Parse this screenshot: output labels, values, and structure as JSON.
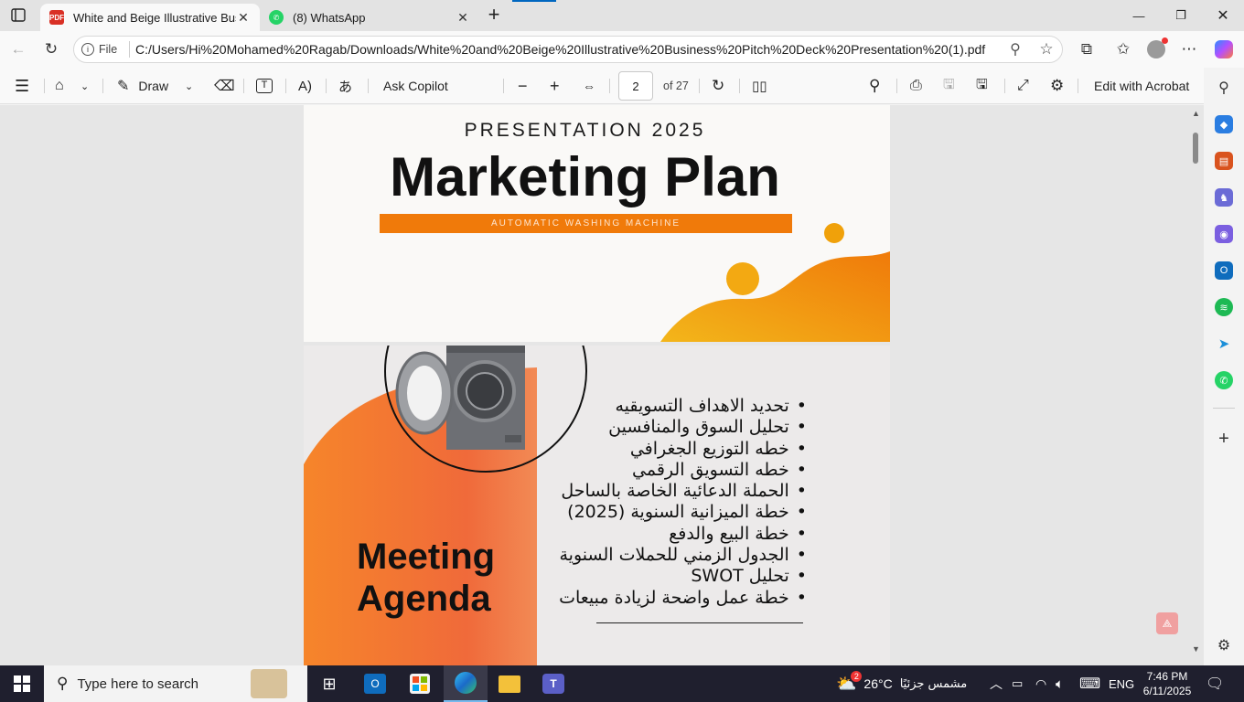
{
  "tabs": [
    {
      "title": "White and Beige Illustrative Busin",
      "icon": "pdf-icon",
      "active": true
    },
    {
      "title": "(8) WhatsApp",
      "icon": "whatsapp-icon",
      "active": false
    }
  ],
  "address": {
    "scheme_label": "File",
    "url": "C:/Users/Hi%20Mohamed%20Ragab/Downloads/White%20and%20Beige%20Illustrative%20Business%20Pitch%20Deck%20Presentation%20(1).pdf"
  },
  "pdf_toolbar": {
    "draw_label": "Draw",
    "copilot_label": "Ask Copilot",
    "page_current": "2",
    "page_total": "of 27",
    "edit_label": "Edit with Acrobat"
  },
  "page1": {
    "subtitle": "PRESENTATION 2025",
    "title": "Marketing Plan",
    "banner": "AUTOMATIC WASHING MACHINE"
  },
  "page2": {
    "heading_line1": "Meeting",
    "heading_line2": "Agenda",
    "agenda_items": [
      "تحديد الاهداف التسويقيه",
      "تحليل السوق والمنافسين",
      "خطه التوزيع الجغرافي",
      "خطه التسويق الرقمي",
      "الحملة الدعائية الخاصة بالساحل",
      "خطة الميزانية السنوية (2025)",
      "خطة البيع والدفع",
      "الجدول الزمني للحملات السنوية",
      "تحليل SWOT",
      "خطة عمل واضحة لزيادة مبيعات"
    ]
  },
  "taskbar": {
    "search_placeholder": "Type here to search",
    "weather_temp": "26°C",
    "weather_desc": "مشمس جزئيًا",
    "weather_badge": "2",
    "language": "ENG",
    "time": "7:46 PM",
    "date": "6/11/2025"
  },
  "colors": {
    "orange": "#f07a0a",
    "accent_blue": "#0067c0"
  }
}
